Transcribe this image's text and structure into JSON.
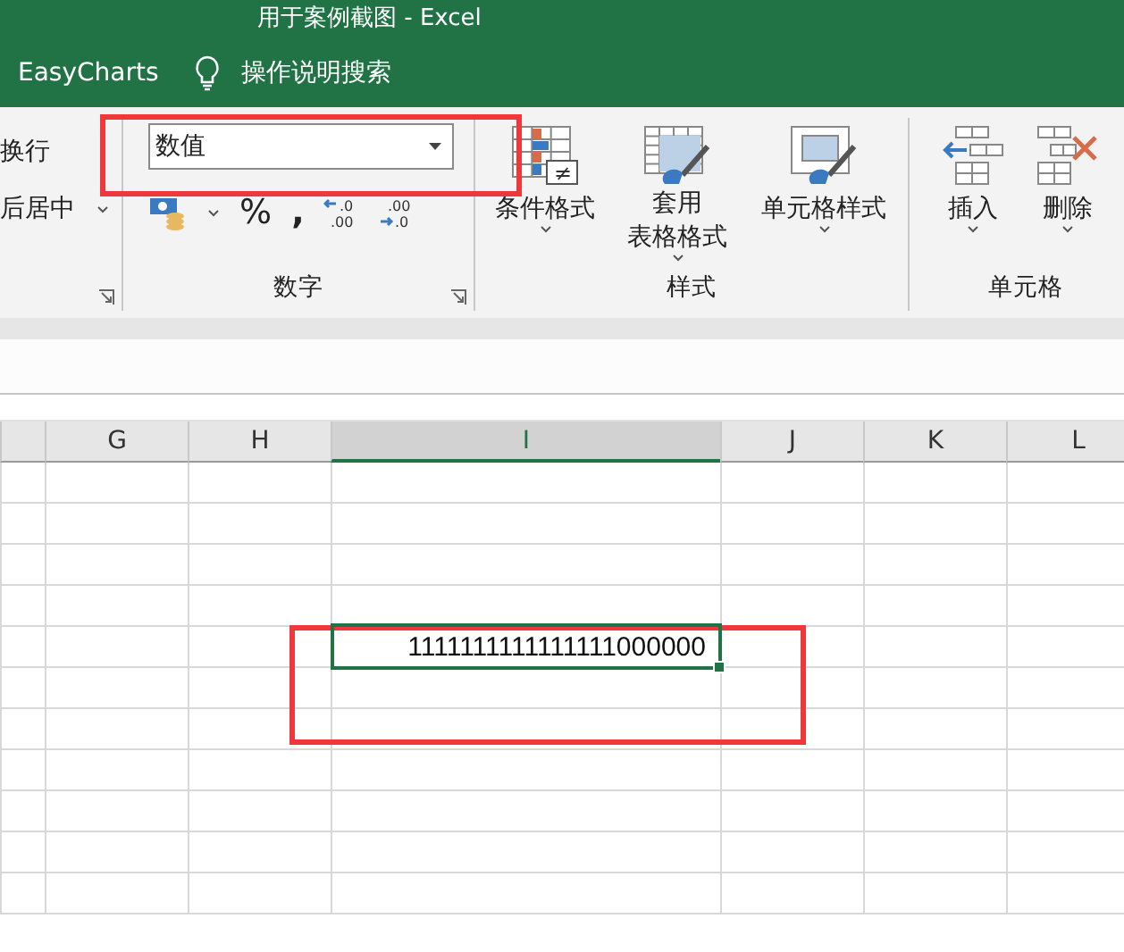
{
  "window": {
    "title": "用于案例截图 - Excel"
  },
  "tabs": [
    {
      "label": "EasyCharts",
      "selected": false
    }
  ],
  "search": {
    "placeholder": "操作说明搜索"
  },
  "ribbon": {
    "alignment": {
      "items": [
        {
          "label": "换行",
          "kind": "plain"
        },
        {
          "label": "后居中",
          "kind": "split"
        }
      ]
    },
    "number": {
      "format": "数值",
      "buttons": [
        {
          "kind": "currency"
        },
        {
          "kind": "percent",
          "label": "%"
        },
        {
          "kind": "comma",
          "label": ","
        },
        {
          "kind": "increase",
          "top": ".0",
          "bottom": ".00"
        },
        {
          "kind": "decrease",
          "top": ".00",
          "bottom": ".0"
        }
      ],
      "label": "数字"
    },
    "styles": {
      "buttons": [
        {
          "kind": "conditional",
          "badge": "≠",
          "lines": [
            "条件格式"
          ]
        },
        {
          "kind": "table",
          "lines": [
            "套用",
            "表格格式"
          ]
        },
        {
          "kind": "cell",
          "lines": [
            "单元格样式"
          ]
        }
      ],
      "label": "样式"
    },
    "cells": {
      "buttons": [
        {
          "kind": "insert",
          "label": "插入"
        },
        {
          "kind": "delete",
          "label": "删除"
        }
      ],
      "label": "单元格"
    }
  },
  "sheet": {
    "columns": [
      {
        "label": "G",
        "selected": false
      },
      {
        "label": "H",
        "selected": false
      },
      {
        "label": "I",
        "selected": true
      },
      {
        "label": "J",
        "selected": false
      },
      {
        "label": "K",
        "selected": false
      },
      {
        "label": "L",
        "selected": false
      }
    ],
    "active_cell": {
      "value": "1111111111111111000000"
    }
  }
}
